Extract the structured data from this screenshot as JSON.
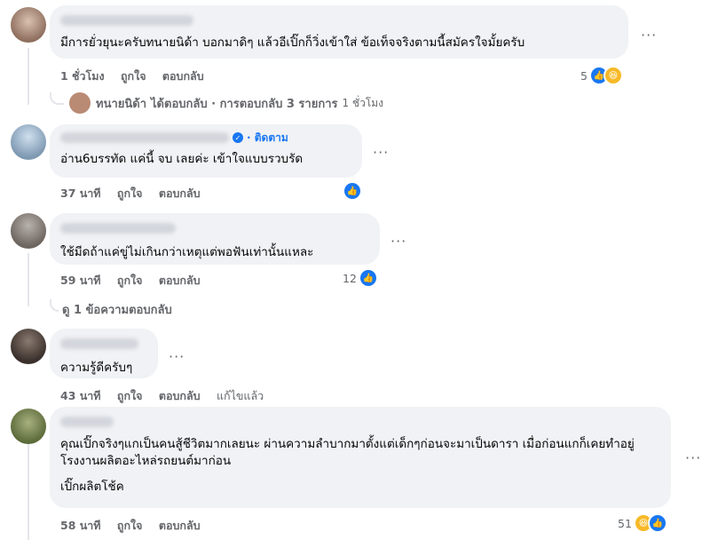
{
  "comments": [
    {
      "text": "มีการยั่วยุนะครับทนายนิด้า บอกมาดิๆ แล้วอีเปิ๊กก็วิ่งเข้าใส่ ข้อเท็จจริงตามนี้สมัครใจมั้ยครับ",
      "time": "1 ชั่วโมง",
      "like": "ถูกใจ",
      "reply": "ตอบกลับ",
      "reaction_count": "5",
      "reactions": [
        "like-icon",
        "haha-icon"
      ]
    },
    {
      "follow_label": "· ติดตาม",
      "text": "อ่าน6บรรทัด แค่นี้ จบ เลยค่ะ เข้าใจแบบรวบรัด",
      "time": "37 นาที",
      "like": "ถูกใจ",
      "reply": "ตอบกลับ",
      "reaction_count": "",
      "reactions": [
        "like-icon"
      ]
    },
    {
      "text": "ใช้มีดถ้าแค่ขู่ไม่เกินกว่าเหตุแต่พอฟันเท่านั้นแหละ",
      "time": "59 นาที",
      "like": "ถูกใจ",
      "reply": "ตอบกลับ",
      "reaction_count": "12",
      "reactions": [
        "like-icon"
      ]
    },
    {
      "text": "ความรู้ดีครับๆ",
      "time": "43 นาที",
      "like": "ถูกใจ",
      "reply": "ตอบกลับ",
      "edited": "แก้ไขแล้ว",
      "reaction_count": "",
      "reactions": []
    },
    {
      "text": "คุณเปิ๊กจริงๆแกเป็นคนสู้ชีวิตมากเลยนะ ผ่านความลำบากมาตั้งแต่เด็กๆก่อนจะมาเป็นดารา เมื่อก่อนแกก็เคยทำอยู่โรงงานผลิตอะไหล่รถยนต์มาก่อน",
      "text2": "เปิ๊กผลิตโช้ค",
      "time": "58 นาที",
      "like": "ถูกใจ",
      "reply": "ตอบกลับ",
      "reaction_count": "51",
      "reactions": [
        "haha-icon",
        "like-icon"
      ]
    }
  ],
  "replies_summary": {
    "name": "ทนายนิด้า",
    "text": "ได้ตอบกลับ · การตอบกลับ 3 รายการ",
    "time": "1 ชั่วโมง"
  },
  "view_replies": "ดู 1 ข้อความตอบกลับ",
  "more_glyph": "···",
  "colors": {
    "bubble": "#f0f2f5",
    "meta": "#65676b",
    "like_blue": "#1877f2",
    "haha_yellow": "#f7b928"
  }
}
